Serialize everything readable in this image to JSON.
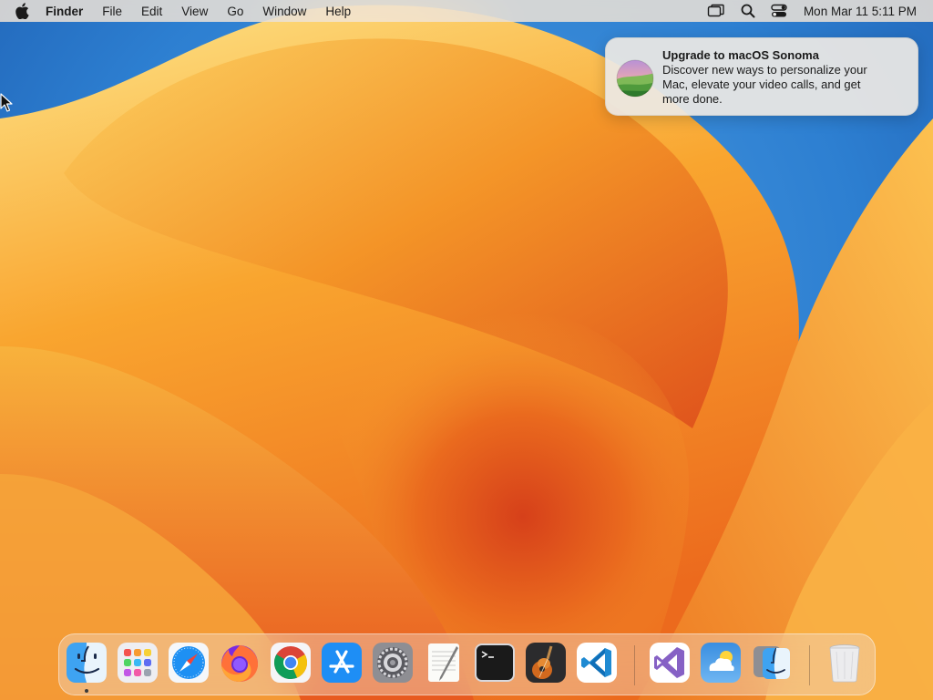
{
  "menubar": {
    "app_name": "Finder",
    "items": [
      "File",
      "Edit",
      "View",
      "Go",
      "Window",
      "Help"
    ],
    "clock": "Mon Mar 11  5:11 PM",
    "status_icons": [
      "screen-mirroring-icon",
      "spotlight-search-icon",
      "control-center-icon"
    ]
  },
  "notification": {
    "title": "Upgrade to macOS Sonoma",
    "body": "Discover new ways to personalize your Mac, elevate your video calls, and get more done."
  },
  "dock": {
    "apps": [
      {
        "name": "Finder",
        "icon": "finder-icon",
        "running": true
      },
      {
        "name": "Launchpad",
        "icon": "launchpad-icon",
        "running": false
      },
      {
        "name": "Safari",
        "icon": "safari-icon",
        "running": false
      },
      {
        "name": "Firefox",
        "icon": "firefox-icon",
        "running": false
      },
      {
        "name": "Google Chrome",
        "icon": "chrome-icon",
        "running": false
      },
      {
        "name": "App Store",
        "icon": "app-store-icon",
        "running": false
      },
      {
        "name": "System Settings",
        "icon": "system-settings-icon",
        "running": false
      },
      {
        "name": "TextEdit",
        "icon": "textedit-icon",
        "running": false
      },
      {
        "name": "Terminal",
        "icon": "terminal-icon",
        "running": false
      },
      {
        "name": "GarageBand",
        "icon": "garageband-icon",
        "running": false
      },
      {
        "name": "Visual Studio Code",
        "icon": "vscode-icon",
        "running": false
      }
    ],
    "recent_apps": [
      {
        "name": "Visual Studio",
        "icon": "visual-studio-icon"
      },
      {
        "name": "Weather",
        "icon": "weather-icon"
      },
      {
        "name": "Migration Assistant",
        "icon": "migration-assistant-icon"
      }
    ],
    "trash": {
      "name": "Trash",
      "icon": "trash-icon"
    }
  },
  "colors": {
    "wallpaper_blue": "#2d7fd1",
    "wallpaper_orange": "#f08a24",
    "wallpaper_yellow": "#fbc94a",
    "wallpaper_red": "#d8431e"
  }
}
